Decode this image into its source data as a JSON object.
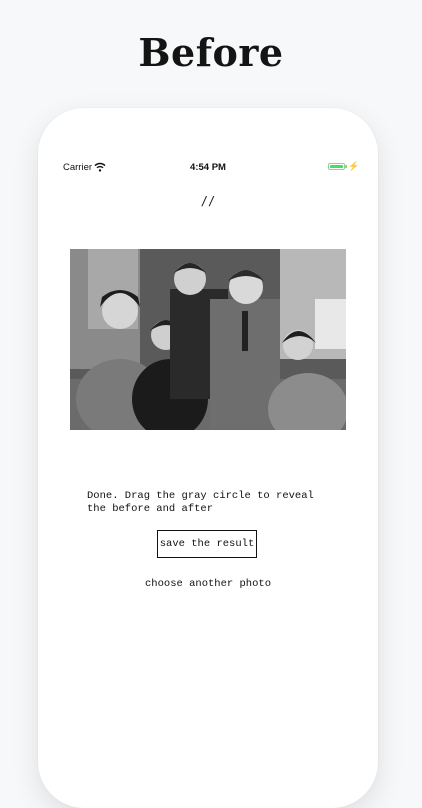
{
  "headline": "Before",
  "status_bar": {
    "carrier": "Carrier",
    "time": "4:54 PM",
    "battery_color": "#4cd964"
  },
  "app": {
    "menu_glyph": "//",
    "status_message": "Done. Drag the gray circle to reveal the before and after",
    "save_button": "save the result",
    "another_photo_link": "choose another photo"
  },
  "icons": [
    "wifi-icon",
    "battery-icon",
    "charging-bolt-icon"
  ],
  "colors": {
    "background": "#f6f8f9",
    "phone": "#ffffff",
    "text": "#111111"
  }
}
